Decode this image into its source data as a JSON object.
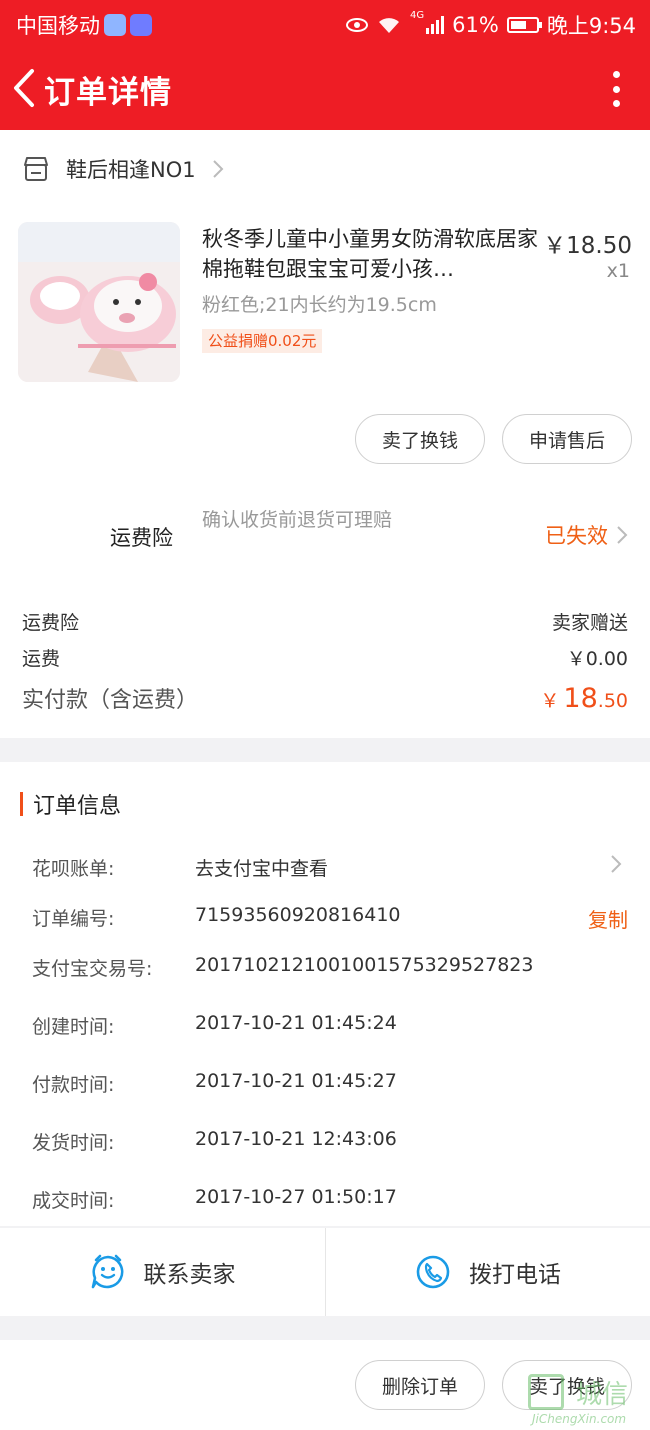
{
  "status_bar": {
    "carrier": "中国移动",
    "network": "4G",
    "battery": "61%",
    "time": "晚上9:54"
  },
  "header": {
    "title": "订单详情"
  },
  "shop": {
    "name": "鞋后相逢NO1"
  },
  "product": {
    "title": "秋冬季儿童中小童男女防滑软底居家棉拖鞋包跟宝宝可爱小孩…",
    "price": "￥18.50",
    "qty": "x1",
    "sku": "粉红色;21内长约为19.5cm",
    "tag": "公益捐赠0.02元"
  },
  "item_actions": {
    "sell": "卖了换钱",
    "after_sale": "申请售后"
  },
  "insurance": {
    "label": "运费险",
    "desc": "确认收货前退货可理赔",
    "status": "已失效"
  },
  "fees": {
    "ins_label": "运费险",
    "ins_value": "卖家赠送",
    "ship_label": "运费",
    "ship_value": "￥0.00",
    "total_label": "实付款（含运费）",
    "total_cur": "￥",
    "total_int": "18",
    "total_dec": ".50"
  },
  "order_info": {
    "title": "订单信息",
    "rows": [
      {
        "key": "花呗账单:",
        "value": "去支付宝中查看"
      },
      {
        "key": "订单编号:",
        "value": "71593560920816410",
        "action": "复制"
      },
      {
        "key": "支付宝交易号:",
        "value": "2017102121001001575329527823"
      },
      {
        "key": "创建时间:",
        "value": "2017-10-21 01:45:24"
      },
      {
        "key": "付款时间:",
        "value": "2017-10-21 01:45:27"
      },
      {
        "key": "发货时间:",
        "value": "2017-10-21 12:43:06"
      },
      {
        "key": "成交时间:",
        "value": "2017-10-27 01:50:17"
      }
    ]
  },
  "contact": {
    "seller": "联系卖家",
    "call": "拨打电话"
  },
  "bottom_actions": {
    "delete": "删除订单",
    "sell": "卖了换钱"
  },
  "watermark": {
    "text": "城信",
    "url": "JiChengXin.com"
  },
  "colors": {
    "header_red": "#ee1d25",
    "accent_orange": "#ef6016",
    "contact_blue": "#1a9be6"
  }
}
